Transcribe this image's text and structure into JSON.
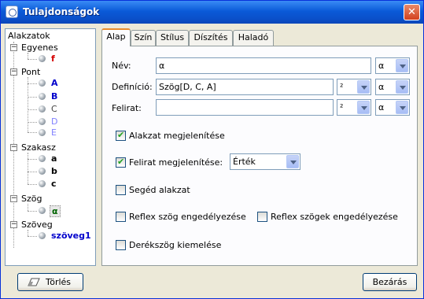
{
  "window": {
    "title": "Tulajdonságok",
    "close_glyph": "✕"
  },
  "tree": {
    "root": "Alakzatok",
    "groups": [
      {
        "label": "Egyenes",
        "items": [
          {
            "label": "f",
            "color": "#d40000"
          }
        ]
      },
      {
        "label": "Pont",
        "items": [
          {
            "label": "A",
            "color": "#0000cc"
          },
          {
            "label": "B",
            "color": "#0000cc"
          },
          {
            "label": "C",
            "color": "#444444"
          },
          {
            "label": "D",
            "color": "#8080ff"
          },
          {
            "label": "E",
            "color": "#8080ff"
          }
        ]
      },
      {
        "label": "Szakasz",
        "items": [
          {
            "label": "a",
            "color": "#000000"
          },
          {
            "label": "b",
            "color": "#000000"
          },
          {
            "label": "c",
            "color": "#000000"
          }
        ]
      },
      {
        "label": "Szög",
        "items": [
          {
            "label": "α",
            "color": "#006400"
          }
        ]
      },
      {
        "label": "Szöveg",
        "items": [
          {
            "label": "szöveg1",
            "color": "#0000cc"
          }
        ]
      }
    ],
    "expand_glyph": "−"
  },
  "tabs": [
    "Alap",
    "Szín",
    "Stílus",
    "Díszítés",
    "Haladó"
  ],
  "form": {
    "name_label": "Név:",
    "name_value": "α",
    "name_combo": "α",
    "definition_label": "Definíció:",
    "definition_value": "Szög[D, C, A]",
    "definition_combo1": "²",
    "definition_combo2": "α",
    "caption_label": "Felirat:",
    "caption_value": "",
    "caption_combo1": "²",
    "caption_combo2": "α",
    "show_object": "Alakzat megjelenítése",
    "show_label": "Felirat megjelenítése:",
    "label_mode": "Érték",
    "auxiliary": "Segéd alakzat",
    "reflex_angle": "Reflex szög engedélyezése",
    "reflex_angles": "Reflex szögek engedélyezése",
    "right_angle": "Derékszög kiemelése"
  },
  "buttons": {
    "delete": "Törlés",
    "close": "Bezárás"
  }
}
